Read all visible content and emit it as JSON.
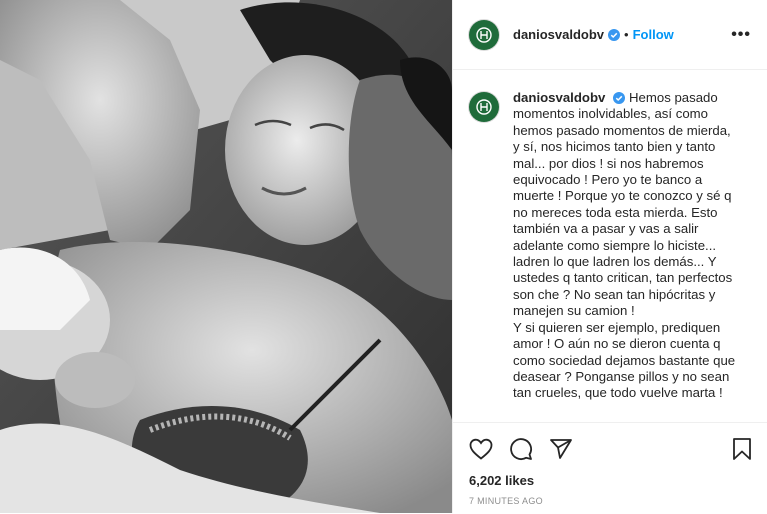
{
  "colors": {
    "accent": "#0095f6",
    "verified": "#3897f0",
    "avatar_bg": "#1f6b3a"
  },
  "photo": {
    "description_icon": "photo-image",
    "tone": "black-and-white"
  },
  "header": {
    "username": "daniosvaldobv",
    "separator": "•",
    "follow_label": "Follow",
    "more_label": "•••"
  },
  "caption": {
    "username": "daniosvaldobv",
    "lines": [
      "Hemos pasado",
      "momentos inolvidables, así como",
      "hemos pasado momentos de mierda,",
      "y sí, nos hicimos tanto bien y tanto",
      "mal... por dios ! si nos habremos",
      "equivocado ! Pero yo te banco a",
      "muerte ! Porque yo te conozco y sé q",
      "no mereces toda esta mierda. Esto",
      "también va a pasar y vas a salir",
      "adelante como siempre lo hiciste...",
      "ladren lo que ladren los demás... Y",
      "ustedes q tanto critican, tan perfectos",
      "son che ? No sean tan hipócritas y",
      "manejen su camion !",
      "Y si quieren ser ejemplo, prediquen",
      "amor ! O aún no se dieron cuenta q",
      "como sociedad dejamos bastante que",
      "deasear ? Ponganse pillos y no sean",
      "tan crueles, que todo vuelve marta !"
    ]
  },
  "actions": {
    "like_icon": "heart-icon",
    "comment_icon": "comment-icon",
    "share_icon": "share-icon",
    "save_icon": "bookmark-icon"
  },
  "likes": "6,202 likes",
  "timestamp": "7 MINUTES AGO"
}
